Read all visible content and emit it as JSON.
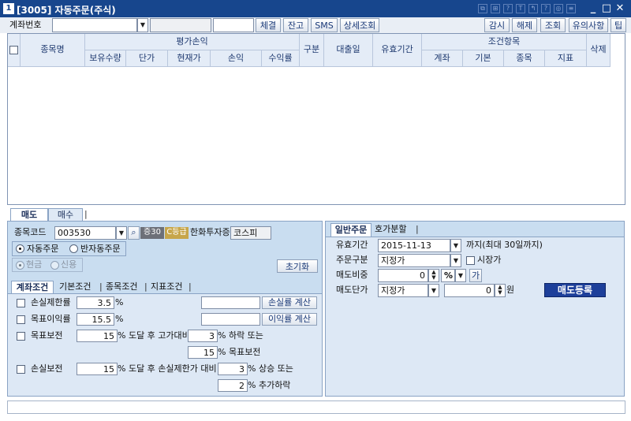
{
  "window": {
    "title": "[3005] 자동주문(주식)",
    "icon_label": "1",
    "tb_icons": [
      "⧉",
      "⊞",
      "?",
      "T",
      "↰",
      "?",
      "◎",
      "≡"
    ],
    "win_buttons": {
      "minimize": "_",
      "maximize": "□",
      "close": "✕"
    }
  },
  "toolbar": {
    "account_label": "계좌번호",
    "account_value": "",
    "buttons": {
      "execution": "체결",
      "balance": "잔고",
      "sms": "SMS",
      "detail": "상세조회"
    },
    "right_buttons": {
      "monitor": "감시",
      "release": "해제",
      "inquire": "조회",
      "notice": "유의사항",
      "tip": "팁"
    }
  },
  "grid": {
    "headers": {
      "stock_name": "종목명",
      "valuation_group": "평가손익",
      "holding_qty": "보유수량",
      "unit_price": "단가",
      "current_price": "현재가",
      "pnl": "손익",
      "return_rate": "수익률",
      "division": "구분",
      "loan_date": "대출일",
      "valid_period": "유효기간",
      "condition_group": "조건항목",
      "cond_account": "계좌",
      "cond_basic": "기본",
      "cond_stock": "종목",
      "cond_indicator": "지표",
      "delete": "삭제"
    }
  },
  "left_panel": {
    "tabs": {
      "sell": "매도",
      "buy": "매수"
    },
    "stock_code_label": "종목코드",
    "stock_code_value": "003530",
    "badges": {
      "margin": "증30",
      "grade": "C등급"
    },
    "stock_name": "한화투자증",
    "market": "코스피",
    "order_type": {
      "auto": "자동주문",
      "semi": "반자동주문"
    },
    "cash_type": {
      "cash": "현금",
      "credit": "신용"
    },
    "reset_button": "초기화",
    "cond_tabs": {
      "account": "계좌조건",
      "basic": "기본조건",
      "stock": "종목조건",
      "indicator": "지표조건"
    },
    "rows": {
      "stop_loss_label": "손실제한률",
      "stop_loss_value": "3.5",
      "target_label": "목표이익률",
      "target_value": "15.5",
      "pct": "%",
      "calc_loss_button": "손실률 계산",
      "calc_profit_button": "이익률 계산",
      "target_keep_label": "목표보전",
      "target_keep_value": "15",
      "reach_high_text": "% 도달 후 고가대비",
      "drop_value": "3",
      "drop_text": "% 하락 또는",
      "keep_value": "15",
      "keep_text": "% 목표보전",
      "loss_keep_label": "손실보전",
      "loss_keep_value": "15",
      "reach_loss_text": "% 도달 후 손실제한가 대비",
      "rise_value": "3",
      "rise_text": "% 상승 또는",
      "extra_value": "2",
      "extra_text": "% 추가하락"
    }
  },
  "right_panel": {
    "tabs": {
      "normal": "일반주문",
      "hoga": "호가분할"
    },
    "valid_period_label": "유효기간",
    "valid_period_value": "2015-11-13",
    "valid_period_note": "까지(최대 30일까지)",
    "order_div_label": "주문구분",
    "order_div_value": "지정가",
    "market_price_label": "시장가",
    "sell_ratio_label": "매도비중",
    "sell_ratio_value": "0",
    "sell_ratio_unit": "%",
    "add_button": "가",
    "sell_price_label": "매도단가",
    "sell_price_type": "지정가",
    "sell_price_value": "0",
    "won": "원",
    "register_button": "매도등록"
  },
  "colors": {
    "title_bar": "#17468d",
    "panel_bg": "#c9ddf0",
    "register_btn": "#1d3f9a",
    "grade_badge": "#c7a64b"
  }
}
